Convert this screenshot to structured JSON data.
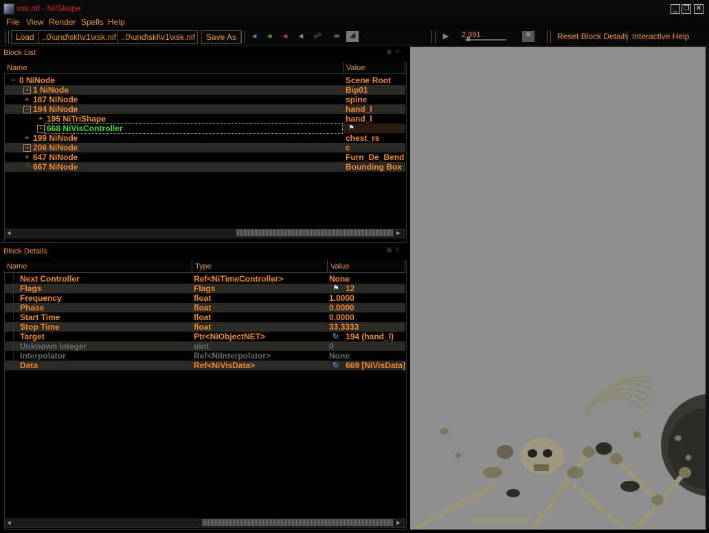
{
  "window": {
    "title": "xsk.nif - NifSkope",
    "controls": [
      "_",
      "❐",
      "✕"
    ]
  },
  "menu": {
    "items": [
      {
        "label": "File",
        "access": "F"
      },
      {
        "label": "View",
        "access": "V"
      },
      {
        "label": "Render",
        "access": "R"
      },
      {
        "label": "Spells",
        "access": "S"
      },
      {
        "label": "Help",
        "access": "H"
      }
    ]
  },
  "toolbar": {
    "load_label": "Load",
    "load_path": "..0\\und\\skl\\v1\\xsk.nif",
    "save_path": "..0\\und\\skl\\v1\\xsk.nif",
    "save_as_label": "Save As",
    "time_value": "2.391",
    "reset_label": "Reset Block Details",
    "help_label": "Interactive Help"
  },
  "block_list": {
    "title": "Block List",
    "col_name": "Name",
    "col_value": "Value",
    "rows": [
      {
        "exp": "−",
        "name": "0 NiNode",
        "value": "Scene Root"
      },
      {
        "exp": "+",
        "name": "1 NiNode",
        "value": "Bip01"
      },
      {
        "exp": "+",
        "name": "187 NiNode",
        "value": "spine"
      },
      {
        "exp": "−",
        "name": "194 NiNode",
        "value": "hand_l"
      },
      {
        "exp": "+",
        "name": "195 NiTriShape",
        "value": "hand_l"
      },
      {
        "exp": "+",
        "name": "668 NiVisController",
        "value": ""
      },
      {
        "exp": "+",
        "name": "199 NiNode",
        "value": "chest_rs"
      },
      {
        "exp": "+",
        "name": "206 NiNode",
        "value": "c"
      },
      {
        "exp": "+",
        "name": "647 NiNode",
        "value": "Furn_De_Bend"
      },
      {
        "exp": "",
        "name": "667 NiNode",
        "value": "Bounding Box"
      }
    ]
  },
  "block_details": {
    "title": "Block Details",
    "col_name": "Name",
    "col_type": "Type",
    "col_value": "Value",
    "rows": [
      {
        "name": "Next Controller",
        "type": "Ref<NiTimeController>",
        "value": "None"
      },
      {
        "name": "Flags",
        "type": "Flags",
        "value": "12"
      },
      {
        "name": "Frequency",
        "type": "float",
        "value": "1.0000"
      },
      {
        "name": "Phase",
        "type": "float",
        "value": "0.0000"
      },
      {
        "name": "Start Time",
        "type": "float",
        "value": "0.0000"
      },
      {
        "name": "Stop Time",
        "type": "float",
        "value": "33.3333"
      },
      {
        "name": "Target",
        "type": "Ptr<NiObjectNET>",
        "value": "194 (hand_l)"
      },
      {
        "name": "Unknown Integer",
        "type": "uint",
        "value": "0"
      },
      {
        "name": "Interpolator",
        "type": "Ref<NiInterpolator>",
        "value": "None"
      },
      {
        "name": "Data",
        "type": "Ref<NiVisData>",
        "value": "669 [NiVisData]"
      }
    ]
  },
  "colors": {
    "accent": "#f08a28",
    "selected": "#3ddc3d",
    "title_red": "#cc2233",
    "viewport_bg": "#8e8e8e"
  }
}
